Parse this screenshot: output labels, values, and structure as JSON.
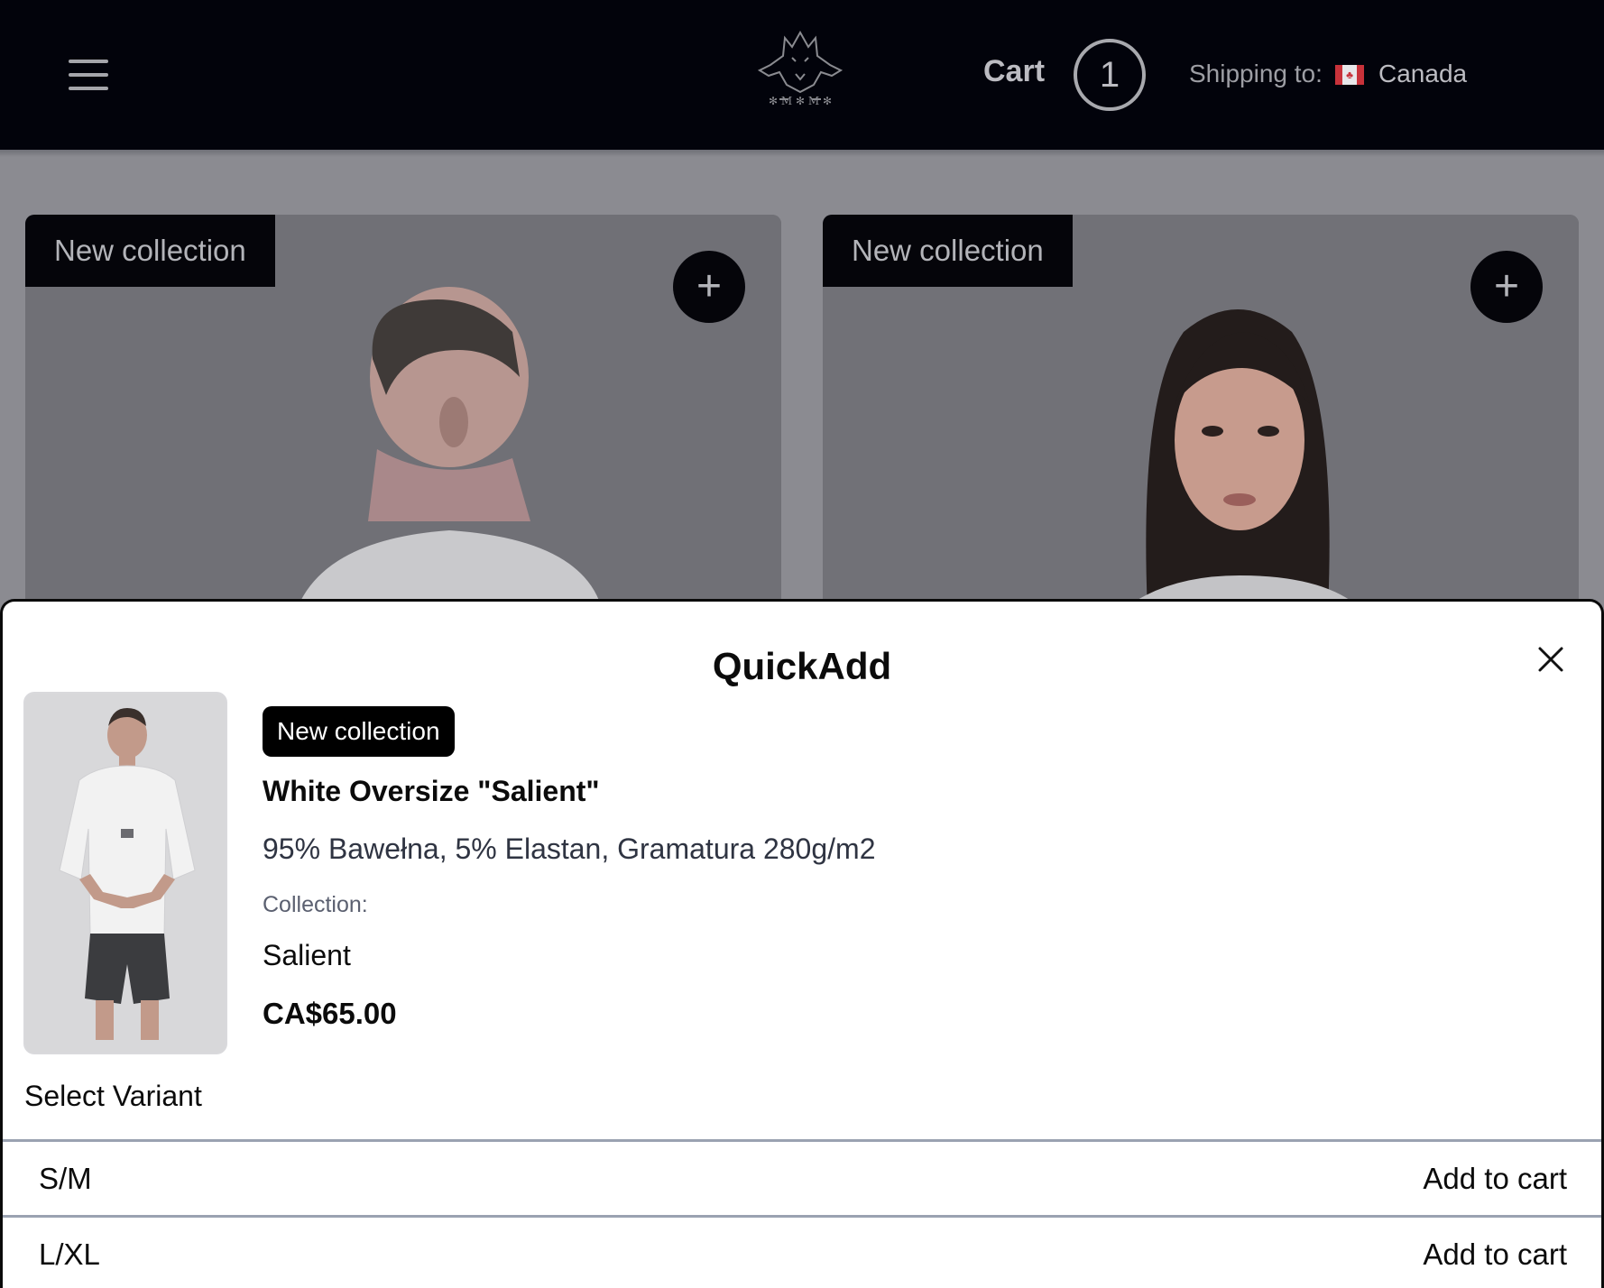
{
  "header": {
    "menu_icon": "hamburger-menu-icon",
    "logo_icon": "dogs-crest-logo",
    "cart_label": "Cart",
    "cart_count": "1",
    "shipping_label": "Shipping to:",
    "shipping_flag": "canada-flag-icon",
    "shipping_country": "Canada"
  },
  "products": [
    {
      "badge": "New collection",
      "add_icon": "plus-icon"
    },
    {
      "badge": "New collection",
      "add_icon": "plus-icon"
    }
  ],
  "quickadd": {
    "title": "QuickAdd",
    "close_icon": "close-icon",
    "badge": "New collection",
    "name": "White Oversize \"Salient\"",
    "description": "95% Bawełna, 5% Elastan, Gramatura 280g/m2",
    "collection_label": "Collection:",
    "collection_value": "Salient",
    "price": "CA$65.00",
    "select_variant_label": "Select Variant",
    "variants": [
      {
        "size": "S/M",
        "action": "Add to cart"
      },
      {
        "size": "L/XL",
        "action": "Add to cart"
      }
    ]
  },
  "colors": {
    "header_bg": "#02030b",
    "overlay_bg": "#8b8b91",
    "modal_bg": "#ffffff",
    "badge_bg": "#000000"
  }
}
